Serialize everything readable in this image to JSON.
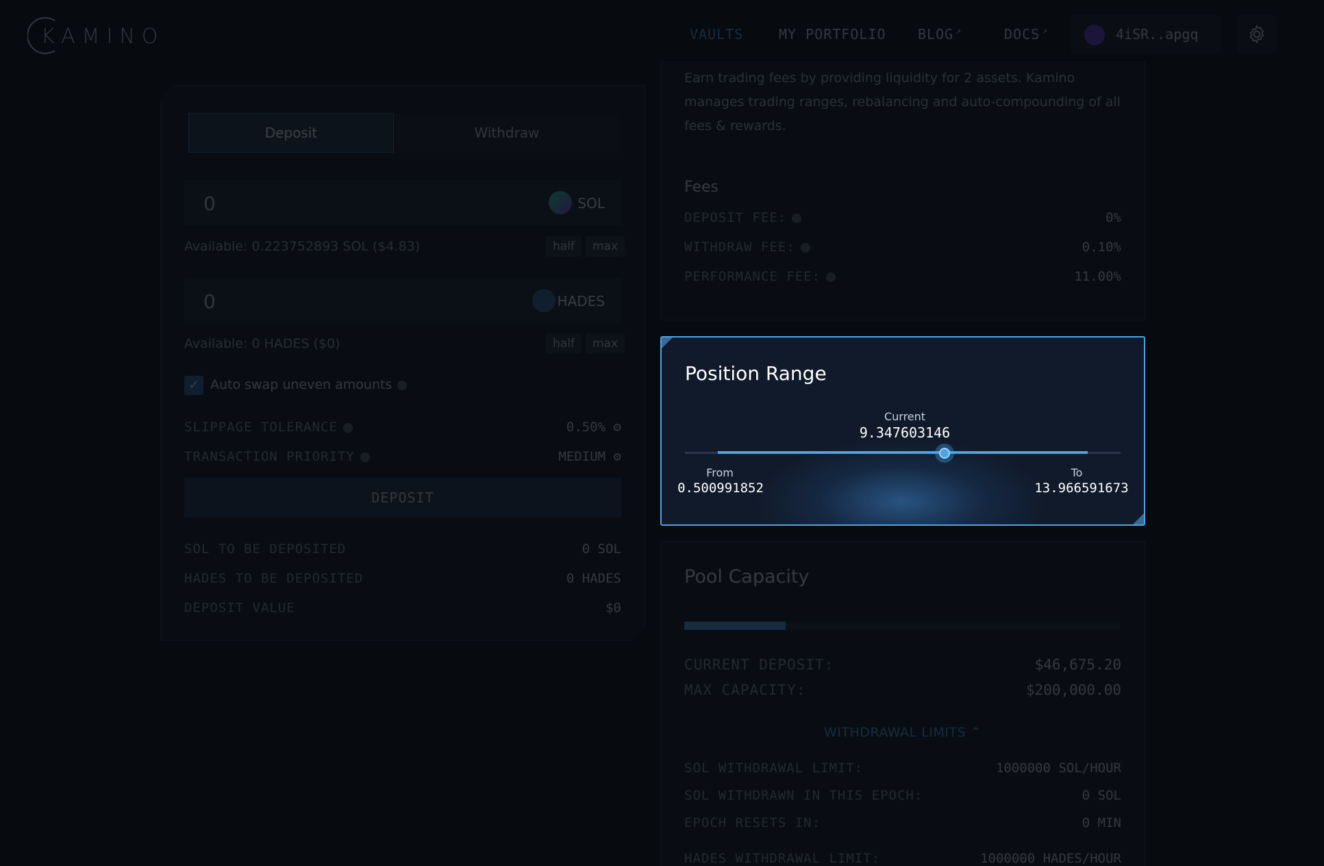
{
  "header": {
    "logo_text": "KAMINO",
    "nav": [
      {
        "label": "VAULTS",
        "external": false,
        "active": true
      },
      {
        "label": "MY PORTFOLIO",
        "external": false,
        "active": false
      },
      {
        "label": "BLOG",
        "external": true,
        "active": false
      },
      {
        "label": "DOCS",
        "external": true,
        "active": false
      }
    ],
    "external_glyph": "↗",
    "wallet": "4iSR..apgq",
    "settings_icon": "gear-icon"
  },
  "deposit_panel": {
    "tabs": [
      "Deposit",
      "Withdraw"
    ],
    "active_tab": "Deposit",
    "inputs": [
      {
        "value": "0",
        "token": "SOL",
        "available": "Available: 0.223752893 SOL ($4.83)"
      },
      {
        "value": "0",
        "token": "HADES",
        "available": "Available: 0 HADES ($0)"
      }
    ],
    "half_label": "half",
    "max_label": "max",
    "auto_swap_label": "Auto swap uneven amounts",
    "auto_swap_checked": true,
    "slippage_label": "SLIPPAGE TOLERANCE",
    "slippage_value": "0.50%",
    "priority_label": "TRANSACTION PRIORITY",
    "priority_value": "MEDIUM",
    "deposit_button": "DEPOSIT",
    "summary": [
      {
        "label": "SOL TO BE DEPOSITED",
        "value": "0 SOL"
      },
      {
        "label": "HADES TO BE DEPOSITED",
        "value": "0 HADES"
      },
      {
        "label": "DEPOSIT VALUE",
        "value": "$0"
      }
    ]
  },
  "info_panel": {
    "description": "Earn trading fees by providing liquidity for 2 assets. Kamino manages trading ranges, rebalancing and auto-compounding of all fees & rewards.",
    "fees_title": "Fees",
    "fees": [
      {
        "label": "DEPOSIT FEE:",
        "value": "0%"
      },
      {
        "label": "WITHDRAW FEE:",
        "value": "0.10%"
      },
      {
        "label": "PERFORMANCE FEE:",
        "value": "11.00%"
      }
    ]
  },
  "position_range": {
    "title": "Position Range",
    "current_label": "Current",
    "current_value": "9.347603146",
    "from_label": "From",
    "from_value": "0.500991852",
    "to_label": "To",
    "to_value": "13.966591673"
  },
  "pool_capacity": {
    "title": "Pool Capacity",
    "fill_fraction": 0.233,
    "rows": [
      {
        "label": "CURRENT DEPOSIT:",
        "value": "$46,675.20"
      },
      {
        "label": "MAX CAPACITY:",
        "value": "$200,000.00"
      }
    ],
    "withdrawal_limits_label": "WITHDRAWAL LIMITS",
    "limits": [
      {
        "label": "SOL WITHDRAWAL LIMIT:",
        "value": "1000000 SOL/HOUR"
      },
      {
        "label": "SOL WITHDRAWN IN THIS EPOCH:",
        "value": "0 SOL"
      },
      {
        "label": "EPOCH RESETS IN:",
        "value": "0 MIN"
      },
      {
        "label": "HADES WITHDRAWAL LIMIT:",
        "value": "1000000 HADES/HOUR"
      }
    ]
  },
  "colors": {
    "accent": "#4aa5e8",
    "background": "#070a0f",
    "card": "#111a2a"
  }
}
